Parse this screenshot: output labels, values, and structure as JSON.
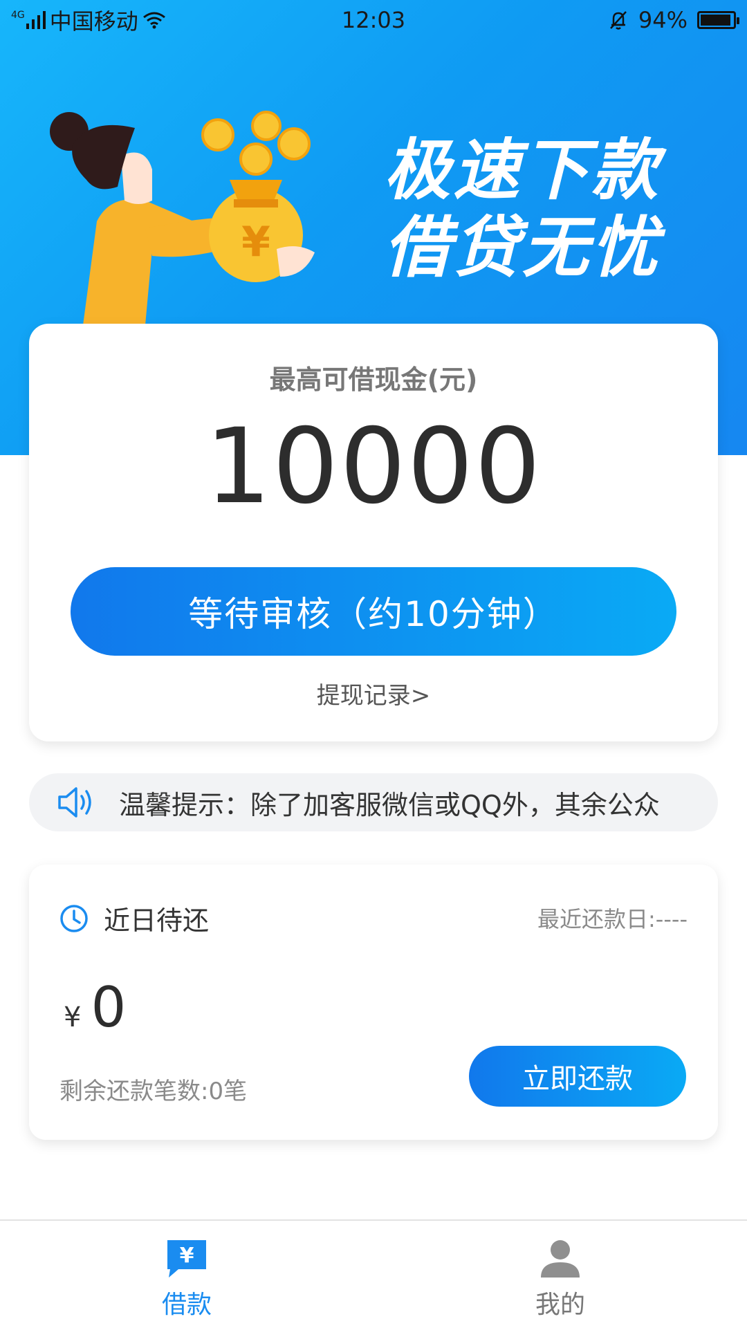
{
  "status_bar": {
    "network": "4G",
    "carrier": "中国移动",
    "time": "12:03",
    "battery": "94%",
    "battery_level": 0.94
  },
  "banner": {
    "slogan_line1": "极速下款",
    "slogan_line2": "借贷无忧",
    "illustration": "woman-holding-money-bag"
  },
  "loan_card": {
    "title": "最高可借现金(元)",
    "amount": "10000",
    "status_button": "等待审核（约10分钟）",
    "record_link": "提现记录>"
  },
  "notice": {
    "icon": "speaker-icon",
    "text": "温馨提示：除了加客服微信或QQ外，其余公众"
  },
  "repay_card": {
    "icon": "clock-icon",
    "title": "近日待还",
    "recent_date": "最近还款日:----",
    "currency": "¥",
    "amount": "0",
    "remaining": "剩余还款笔数:0笔",
    "repay_button": "立即还款"
  },
  "tabbar": {
    "tabs": [
      {
        "label": "借款",
        "icon": "loan-icon",
        "active": true
      },
      {
        "label": "我的",
        "icon": "user-icon",
        "active": false
      }
    ]
  },
  "colors": {
    "primary": "#1a8cf0",
    "banner_start": "#17b6fb",
    "banner_end": "#1687f1"
  }
}
